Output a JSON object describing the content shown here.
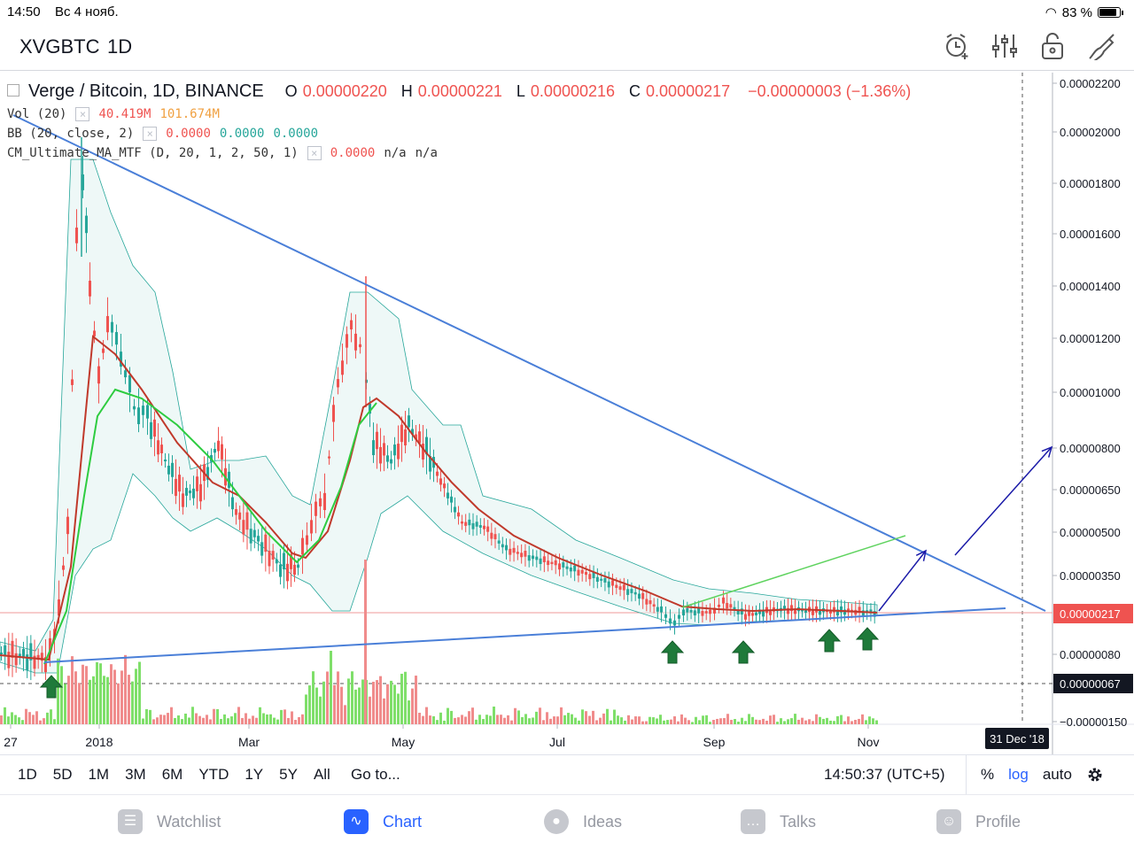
{
  "status_bar": {
    "time": "14:50",
    "date": "Вс 4 нояб.",
    "battery": "83 %"
  },
  "header": {
    "symbol": "XVGBTC",
    "interval": "1D"
  },
  "legend": {
    "title": "Verge / Bitcoin, 1D, BINANCE",
    "o_label": "O",
    "o": "0.00000220",
    "h_label": "H",
    "h": "0.00000221",
    "l_label": "L",
    "l": "0.00000216",
    "c_label": "C",
    "c": "0.00000217",
    "change": "−0.00000003 (−1.36%)",
    "vol_label": "Vol (20)",
    "vol_1": "40.419M",
    "vol_2": "101.674M",
    "bb_label": "BB (20, close, 2)",
    "bb_1": "0.0000",
    "bb_2": "0.0000",
    "bb_3": "0.0000",
    "cm_label": "CM_Ultimate_MA_MTF (D, 20, 1, 2, 50, 1)",
    "cm_1": "0.0000",
    "cm_2": "n/a",
    "cm_3": "n/a"
  },
  "price_axis": [
    "0.00002200",
    "0.00002000",
    "0.00001800",
    "0.00001600",
    "0.00001400",
    "0.00001200",
    "0.00001000",
    "0.00000800",
    "0.00000650",
    "0.00000500",
    "0.00000350",
    "0.00000080",
    "−0.00000150"
  ],
  "price_marker_current": "0.00000217",
  "price_marker_cursor": "0.00000067",
  "time_axis": [
    "27",
    "2018",
    "Mar",
    "May",
    "Jul",
    "Sep",
    "Nov"
  ],
  "time_marker": "31 Dec '18",
  "timebar": {
    "ranges": [
      "1D",
      "5D",
      "1M",
      "3M",
      "6M",
      "YTD",
      "1Y",
      "5Y",
      "All"
    ],
    "goto": "Go to...",
    "clock": "14:50:37 (UTC+5)",
    "percent": "%",
    "log": "log",
    "auto": "auto"
  },
  "tabs": [
    {
      "label": "Watchlist",
      "icon": "watchlist-icon"
    },
    {
      "label": "Chart",
      "icon": "chart-icon"
    },
    {
      "label": "Ideas",
      "icon": "ideas-icon"
    },
    {
      "label": "Talks",
      "icon": "talks-icon"
    },
    {
      "label": "Profile",
      "icon": "profile-icon"
    }
  ],
  "colors": {
    "accent": "#2962ff",
    "up": "#26a69a",
    "down": "#ef5350",
    "ma": "#c0392b",
    "ma_fast": "#2ecc40",
    "trend": "#4a7fd8"
  },
  "chart_data": {
    "type": "candlestick",
    "x_ticks": [
      "2018",
      "Mar",
      "May",
      "Jul",
      "Sep",
      "Nov"
    ],
    "ylabel": "",
    "y_ticks": [
      2.2e-05,
      2e-05,
      1.8e-05,
      1.6e-05,
      1.4e-05,
      1.2e-05,
      1e-05,
      8e-06,
      6.5e-06,
      5e-06,
      3.5e-06,
      8e-07
    ],
    "log_scale": true,
    "last_price": 2.17e-06
  }
}
